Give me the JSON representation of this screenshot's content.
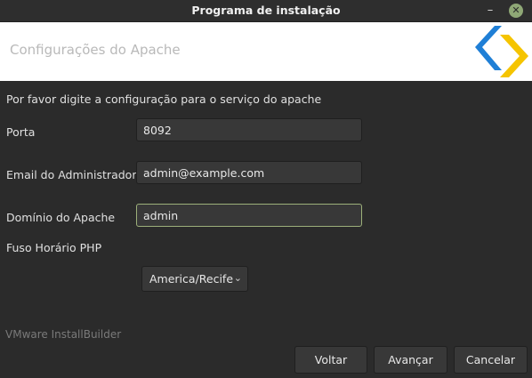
{
  "window": {
    "title": "Programa de instalação",
    "minimize_glyph": "–",
    "close_glyph": "✕"
  },
  "header": {
    "title": "Configurações do Apache",
    "logo_icon": "installbuilder-logo-icon",
    "logo_colors": [
      "#1f7fd6",
      "#f5c400"
    ]
  },
  "form": {
    "intro": "Por favor digite a configuração para o serviço do apache",
    "port_label": "Porta",
    "port_value": "8092",
    "email_label": "Email do Administrador",
    "email_value": "admin@example.com",
    "domain_label": "Domínio do Apache",
    "domain_value": "admin",
    "timezone_label": "Fuso Horário PHP",
    "timezone_value": "America/Recife",
    "chevron_glyph": "⌄"
  },
  "footer": {
    "brand": "VMware InstallBuilder",
    "back_label": "Voltar",
    "next_label": "Avançar",
    "cancel_label": "Cancelar"
  },
  "colors": {
    "background": "#2b2b2b",
    "header_background": "#ffffff",
    "focus_border": "#9db07a",
    "close_button": "#8fa876"
  }
}
